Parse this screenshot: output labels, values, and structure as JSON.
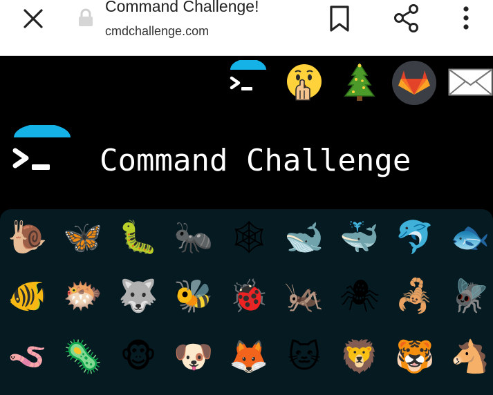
{
  "browser": {
    "title": "Command Challenge!",
    "url": "cmdchallenge.com"
  },
  "header": {
    "brand_title": "Command Challenge"
  },
  "colors": {
    "accent_cyan": "#15b2e8",
    "panel_bg": "#061a22",
    "page_bg": "#000000"
  },
  "nav_icons": [
    "terminal-logo-icon",
    "shushing-face-icon",
    "christmas-tree-icon",
    "gitlab-icon",
    "mail-icon"
  ],
  "animals": [
    [
      "🐌",
      "🦋",
      "🐛",
      "🐜",
      "🕸",
      "🐋",
      "🐳",
      "🐬",
      "🐟"
    ],
    [
      "🐠",
      "🐡",
      "🐺",
      "🐝",
      "🐞",
      "🦗",
      "🕷",
      "🦂",
      "🪰"
    ],
    [
      "🪱",
      "🦠",
      "🐵",
      "🐶",
      "🦊",
      "🐱",
      "🦁",
      "🐯",
      "🐴"
    ]
  ],
  "animal_names": [
    [
      "snail",
      "butterfly",
      "caterpillar",
      "ant",
      "spider-web",
      "whale",
      "spouting-whale",
      "dolphin",
      "fish"
    ],
    [
      "tropical-fish",
      "blowfish",
      "wolf",
      "bee",
      "ladybug",
      "cricket",
      "spider",
      "scorpion",
      "fly"
    ],
    [
      "worm",
      "microbe",
      "monkey",
      "dog",
      "fox",
      "cat",
      "lion",
      "tiger",
      "horse"
    ]
  ]
}
